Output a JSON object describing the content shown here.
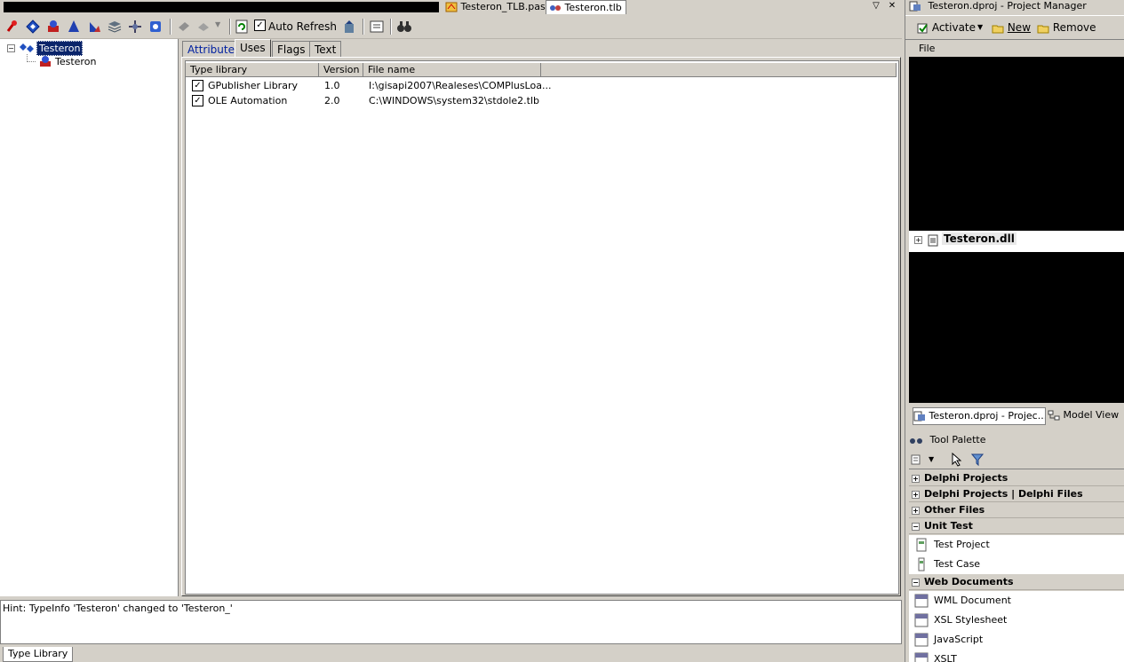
{
  "editor_tabs": [
    {
      "label": "Testeron_TLB.pas",
      "active": false
    },
    {
      "label": "Testeron.tlb",
      "active": true
    }
  ],
  "toolbar": {
    "auto_refresh_label": "Auto Refresh",
    "auto_refresh_checked": true
  },
  "tree": {
    "root": "Testeron",
    "child": "Testeron"
  },
  "panel_tabs": [
    "Attributes",
    "Uses",
    "Flags",
    "Text"
  ],
  "active_tab": "Uses",
  "uses_table": {
    "columns": [
      "Type library",
      "Version",
      "File name"
    ],
    "rows": [
      {
        "checked": true,
        "name": "GPublisher Library",
        "version": "1.0",
        "file": "I:\\gisapi2007\\Realeses\\COMPlusLoa..."
      },
      {
        "checked": true,
        "name": "OLE Automation",
        "version": "2.0",
        "file": "C:\\WINDOWS\\system32\\stdole2.tlb"
      }
    ]
  },
  "message": "Hint: TypeInfo 'Testeron' changed to 'Testeron_'",
  "bottom_tab": "Type Library",
  "project_manager": {
    "title": "Testeron.dproj - Project Manager",
    "activate_label": "Activate",
    "new_label": "New",
    "remove_label": "Remove",
    "file_header": "File",
    "dll_node": "Testeron.dll",
    "tabs": [
      "Testeron.dproj - Projec...",
      "Model View"
    ]
  },
  "tool_palette": {
    "title": "Tool Palette",
    "categories": [
      {
        "label": "Delphi Projects",
        "expanded": false
      },
      {
        "label": "Delphi Projects | Delphi Files",
        "expanded": false
      },
      {
        "label": "Other Files",
        "expanded": false
      },
      {
        "label": "Unit Test",
        "expanded": true,
        "items": [
          "Test Project",
          "Test Case"
        ]
      },
      {
        "label": "Web Documents",
        "expanded": true,
        "items": [
          "WML Document",
          "XSL Stylesheet",
          "JavaScript",
          "XSLT"
        ]
      }
    ]
  },
  "colors": {
    "selection": "#0a246a",
    "window_bg": "#d4d0c8",
    "link_blue": "#000080"
  }
}
